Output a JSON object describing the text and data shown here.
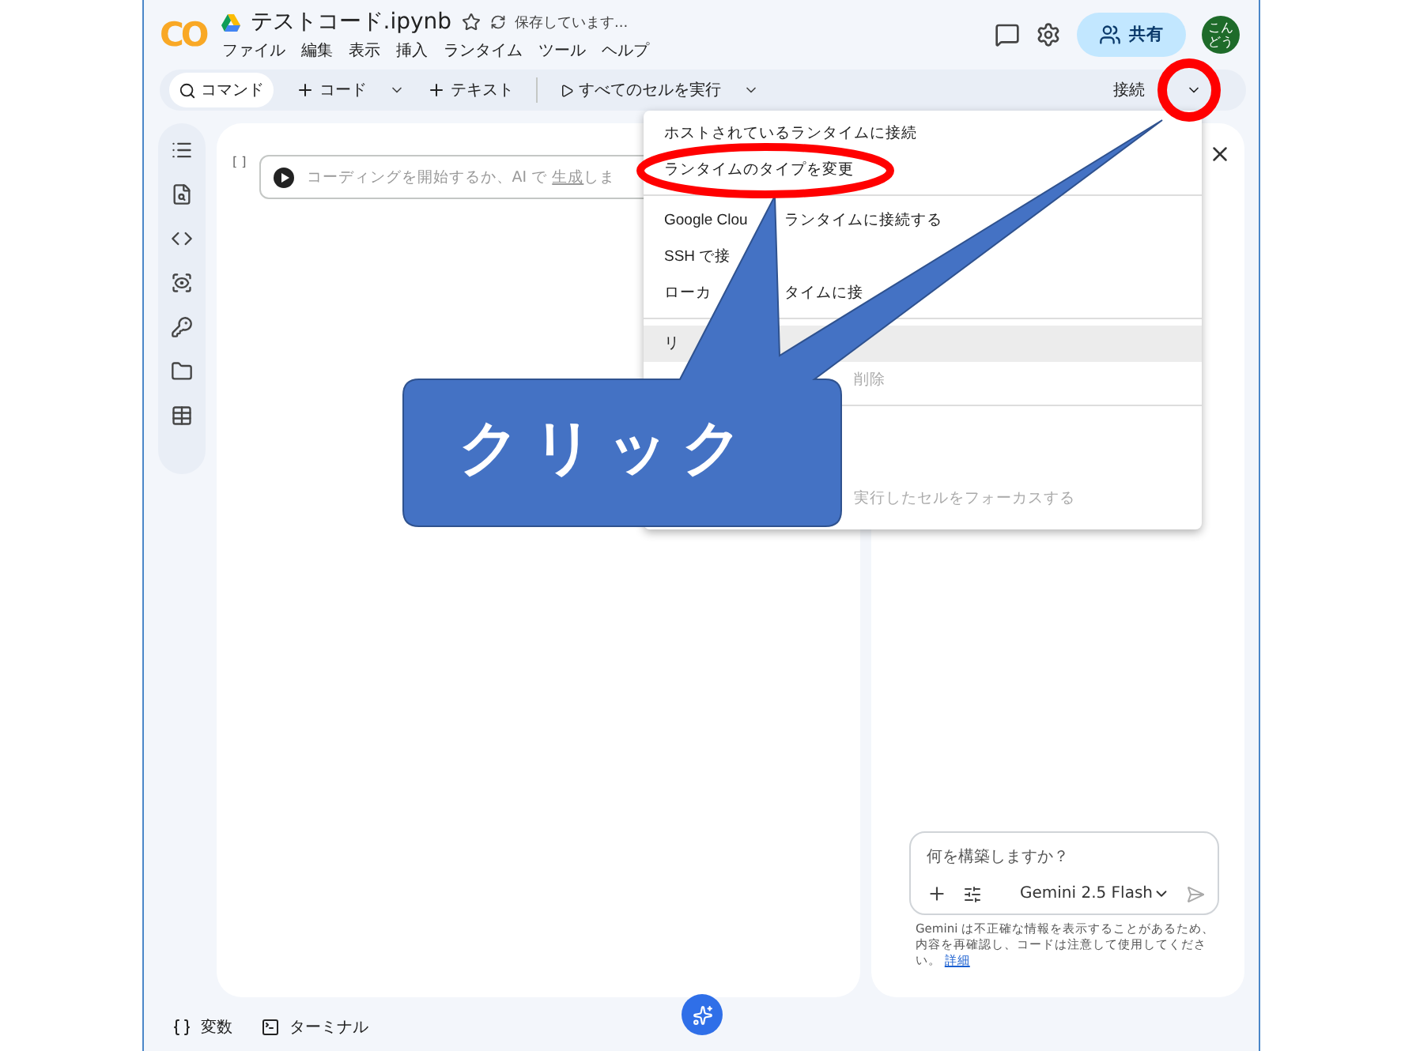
{
  "app": {
    "logo": "CO",
    "title": "テストコード.ipynb",
    "save_status": "保存しています...",
    "share_button": "共有",
    "avatar": "こんどう",
    "menu_bar": [
      "ファイル",
      "編集",
      "表示",
      "挿入",
      "ランタイム",
      "ツール",
      "ヘルプ"
    ]
  },
  "toolbar": {
    "command": "コマンド",
    "add_code": "コード",
    "add_text": "テキスト",
    "run_all": "すべてのセルを実行",
    "connect": "接続"
  },
  "cell": {
    "bracket": "[ ]",
    "prompt_before": "コーディングを開始するか、AI で",
    "prompt_link": "生成",
    "prompt_after": "しま"
  },
  "runtime_menu": {
    "sections": [
      [
        {
          "label": "ホストされているランタイムに接続",
          "disabled": false,
          "highlighted": false
        },
        {
          "label": "ランタイムのタイプを変更",
          "disabled": false,
          "highlighted": false
        }
      ],
      [
        {
          "visible_start": "Google Clou",
          "visible_end": "ランタイムに接続する",
          "disabled": false,
          "highlighted": false
        },
        {
          "visible_start": "SSH で接",
          "disabled": false,
          "highlighted": false
        },
        {
          "visible_start": "ローカ",
          "visible_end": "タイムに接",
          "disabled": false,
          "highlighted": false
        }
      ],
      [
        {
          "visible_start": "リ",
          "disabled": false,
          "highlighted": true
        },
        {
          "visible_end": "削除",
          "disabled": true,
          "highlighted": false
        }
      ],
      [
        {
          "visible_end": "実行したセルをフォーカスする",
          "disabled": true,
          "highlighted": false
        }
      ]
    ]
  },
  "gemini": {
    "placeholder": "何を構築しますか？",
    "model": "Gemini 2.5 Flash",
    "disclaimer": "Gemini は不正確な情報を表示することがあるため、内容を再確認し、コードは注意して使用してください。",
    "disclaimer_link": "詳細"
  },
  "bottom_bar": [
    {
      "kind": "variables",
      "label": "変数"
    },
    {
      "kind": "terminal",
      "label": "ターミナル"
    }
  ],
  "annotation": {
    "callout": "クリック"
  }
}
